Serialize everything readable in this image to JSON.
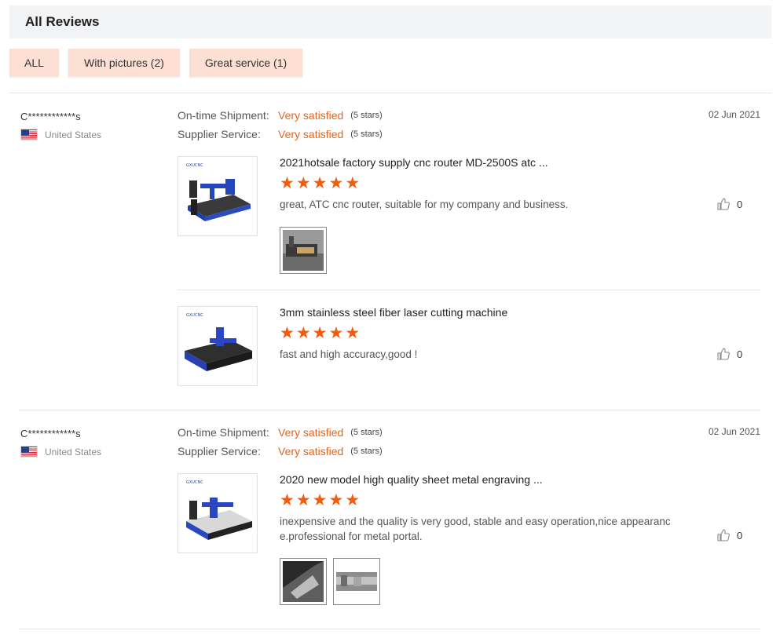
{
  "header": {
    "title": "All Reviews"
  },
  "filters": [
    {
      "label": "ALL"
    },
    {
      "label": "With pictures (2)"
    },
    {
      "label": "Great service (1)"
    }
  ],
  "reviews": [
    {
      "user": "C************s",
      "country": "United States",
      "date": "02 Jun 2021",
      "shipment": {
        "label": "On-time Shipment:",
        "value": "Very satisfied",
        "stars": "(5 stars)"
      },
      "service": {
        "label": "Supplier Service:",
        "value": "Very satisfied",
        "stars": "(5 stars)"
      },
      "products": [
        {
          "title": "2021hotsale factory supply cnc router MD-2500S atc ...",
          "rating": 5,
          "text": "great, ATC cnc router, suitable for my company and business.",
          "likes": "0",
          "photo_count": 1
        },
        {
          "title": "3mm stainless steel fiber laser cutting machine",
          "rating": 5,
          "text": "fast and high accuracy,good !",
          "likes": "0",
          "photo_count": 0
        }
      ]
    },
    {
      "user": "C************s",
      "country": "United States",
      "date": "02 Jun 2021",
      "shipment": {
        "label": "On-time Shipment:",
        "value": "Very satisfied",
        "stars": "(5 stars)"
      },
      "service": {
        "label": "Supplier Service:",
        "value": "Very satisfied",
        "stars": "(5 stars)"
      },
      "products": [
        {
          "title": "2020 new model high quality sheet metal engraving ...",
          "rating": 5,
          "text": "inexpensive and the quality is very good, stable and easy operation,nice appearance.professional for metal portal.",
          "likes": "0",
          "photo_count": 2
        }
      ]
    }
  ],
  "icons": {
    "star": "★",
    "thumbs_up": "thumbs-up-icon",
    "flag": "us-flag-icon"
  },
  "colors": {
    "accent": "#e5631d",
    "star": "#f35c0a",
    "filter_bg": "#fde0d3",
    "header_bg": "#f2f3f5"
  }
}
